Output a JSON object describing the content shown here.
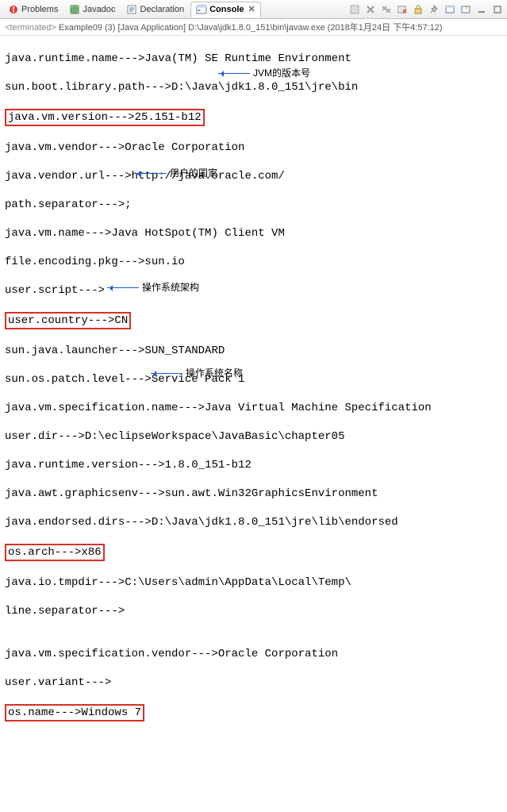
{
  "tabs": {
    "problems": "Problems",
    "javadoc": "Javadoc",
    "declaration": "Declaration",
    "console": "Console"
  },
  "header": {
    "terminated": "<terminated>",
    "run": "Example09 (3) [Java Application] D:\\Java\\jdk1.8.0_151\\bin\\javaw.exe (2018年1月24日 下午4:57:12)"
  },
  "annotations": {
    "jvm_version": "JVM的版本号",
    "user_country": "用户的国家",
    "os_arch": "操作系统架构",
    "os_name": "操作系统名称"
  },
  "out": {
    "l1": "java.runtime.name--->Java(TM) SE Runtime Environment",
    "l2": "sun.boot.library.path--->D:\\Java\\jdk1.8.0_151\\jre\\bin",
    "l3": "java.vm.version--->25.151-b12",
    "l4": "java.vm.vendor--->Oracle Corporation",
    "l5": "java.vendor.url--->http://java.oracle.com/",
    "l6": "path.separator--->;",
    "l7": "java.vm.name--->Java HotSpot(TM) Client VM",
    "l8": "file.encoding.pkg--->sun.io",
    "l9": "user.script--->",
    "l10": "user.country--->CN",
    "l11": "sun.java.launcher--->SUN_STANDARD",
    "l12": "sun.os.patch.level--->Service Pack 1",
    "l13": "java.vm.specification.name--->Java Virtual Machine Specification",
    "l14": "user.dir--->D:\\eclipseWorkspace\\JavaBasic\\chapter05",
    "l15": "java.runtime.version--->1.8.0_151-b12",
    "l16": "java.awt.graphicsenv--->sun.awt.Win32GraphicsEnvironment",
    "l17": "java.endorsed.dirs--->D:\\Java\\jdk1.8.0_151\\jre\\lib\\endorsed",
    "l18": "os.arch--->x86",
    "l19": "java.io.tmpdir--->C:\\Users\\admin\\AppData\\Local\\Temp\\",
    "l20": "line.separator--->",
    "l21": "",
    "l22": "java.vm.specification.vendor--->Oracle Corporation",
    "l23": "user.variant--->",
    "l24": "os.name--->Windows 7"
  }
}
